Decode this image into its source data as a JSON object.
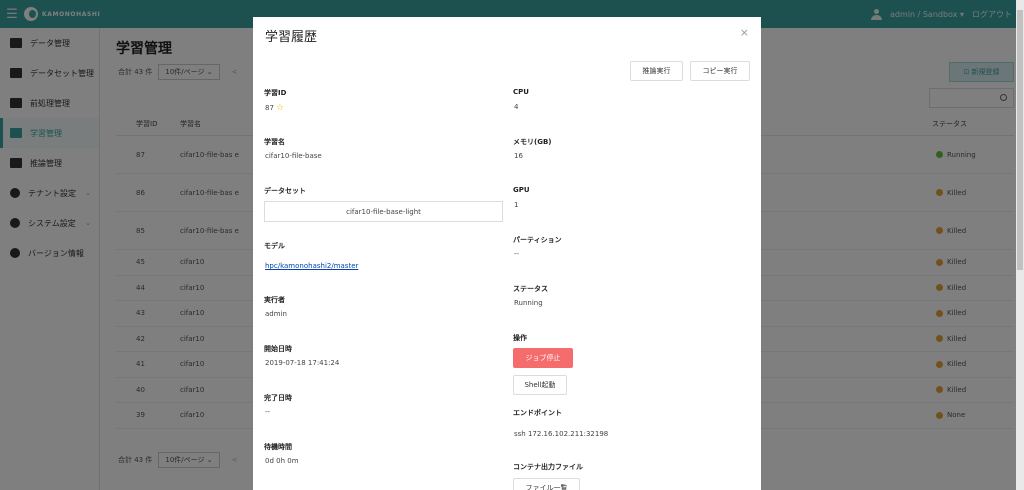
{
  "topbar": {
    "brand": "KAMONOHASHI",
    "user": "admin / Sandbox ▾",
    "logout": "ログアウト"
  },
  "sidebar": {
    "items": [
      {
        "label": "データ管理",
        "icon": "image-icon"
      },
      {
        "label": "データセット管理",
        "icon": "images-icon"
      },
      {
        "label": "前処理管理",
        "icon": "edit-icon"
      },
      {
        "label": "学習管理",
        "icon": "briefcase-icon",
        "active": true
      },
      {
        "label": "推論管理",
        "icon": "clipboard-icon"
      },
      {
        "label": "テナント設定",
        "icon": "gear-icon",
        "caret": "⌄"
      },
      {
        "label": "システム設定",
        "icon": "gears-icon",
        "caret": "⌄"
      },
      {
        "label": "バージョン情報",
        "icon": "info-icon"
      }
    ]
  },
  "page": {
    "title": "学習管理",
    "total": "合計 43 件",
    "per_page": "10件/ページ ⌄",
    "prev": "<",
    "new_button": "⊡ 新規登録",
    "columns": {
      "id": "学習ID",
      "name": "学習名",
      "status": "ステータス"
    },
    "rows": [
      {
        "id": "87",
        "name": "cifar10-file-bas e",
        "status": "Running",
        "color": "#67c23a"
      },
      {
        "id": "86",
        "name": "cifar10-file-bas e",
        "status": "Killed",
        "color": "#e6a23c"
      },
      {
        "id": "85",
        "name": "cifar10-file-bas e",
        "status": "Killed",
        "color": "#e6a23c"
      },
      {
        "id": "45",
        "name": "cifar10",
        "status": "Killed",
        "color": "#e6a23c"
      },
      {
        "id": "44",
        "name": "cifar10",
        "status": "Killed",
        "color": "#e6a23c"
      },
      {
        "id": "43",
        "name": "cifar10",
        "status": "Killed",
        "color": "#e6a23c"
      },
      {
        "id": "42",
        "name": "cifar10",
        "status": "Killed",
        "color": "#e6a23c"
      },
      {
        "id": "41",
        "name": "cifar10",
        "status": "Killed",
        "color": "#e6a23c"
      },
      {
        "id": "40",
        "name": "cifar10",
        "status": "Killed",
        "color": "#e6a23c"
      },
      {
        "id": "39",
        "name": "cifar10",
        "status": "None",
        "color": "#e6a23c"
      }
    ]
  },
  "modal": {
    "title": "学習履歴",
    "close": "×",
    "btn_infer": "推論実行",
    "btn_copy": "コピー実行",
    "left": {
      "id_label": "学習ID",
      "id_value": "87",
      "star": "☆",
      "name_label": "学習名",
      "name_value": "cifar10-file-base",
      "dataset_label": "データセット",
      "dataset_value": "cifar10-file-base-light",
      "model_label": "モデル",
      "model_value": "hpc/kamonohashi2/master",
      "runner_label": "実行者",
      "runner_value": "admin",
      "start_label": "開始日時",
      "start_value": "2019-07-18 17:41:24",
      "end_label": "完了日時",
      "end_value": "--",
      "wait_label": "待機時間",
      "wait_value": "0d 0h 0m"
    },
    "right": {
      "cpu_label": "CPU",
      "cpu_value": "4",
      "mem_label": "メモリ(GB)",
      "mem_value": "16",
      "gpu_label": "GPU",
      "gpu_value": "1",
      "partition_label": "パーティション",
      "partition_value": "--",
      "status_label": "ステータス",
      "status_value": "Running",
      "ops_label": "操作",
      "stop_button": "ジョブ停止",
      "shell_button": "Shell起動",
      "endpoint_label": "エンドポイント",
      "endpoint_value": "ssh 172.16.102.211:32198",
      "output_label": "コンテナ出力ファイル",
      "output_button": "ファイル一覧"
    }
  },
  "colors": {
    "accent": "#3aa3a1",
    "danger": "#f56c6c",
    "running": "#67c23a",
    "killed": "#e6a23c"
  }
}
